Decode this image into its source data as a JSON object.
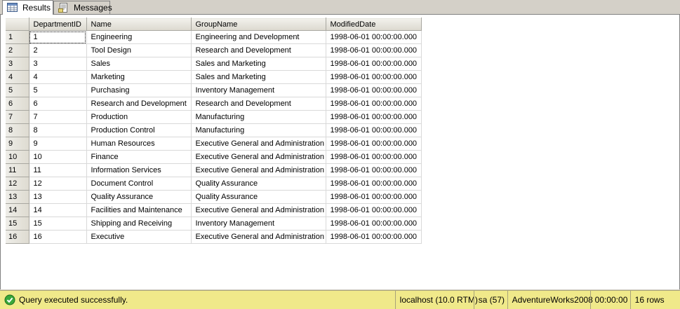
{
  "tabs": [
    {
      "label": "Results",
      "icon": "grid-results-icon",
      "active": true
    },
    {
      "label": "Messages",
      "icon": "messages-icon",
      "active": false
    }
  ],
  "grid": {
    "columns": [
      "DepartmentID",
      "Name",
      "GroupName",
      "ModifiedDate"
    ],
    "rows": [
      [
        "1",
        "1",
        "Engineering",
        "Engineering and Development",
        "1998-06-01 00:00:00.000"
      ],
      [
        "2",
        "2",
        "Tool Design",
        "Research and Development",
        "1998-06-01 00:00:00.000"
      ],
      [
        "3",
        "3",
        "Sales",
        "Sales and Marketing",
        "1998-06-01 00:00:00.000"
      ],
      [
        "4",
        "4",
        "Marketing",
        "Sales and Marketing",
        "1998-06-01 00:00:00.000"
      ],
      [
        "5",
        "5",
        "Purchasing",
        "Inventory Management",
        "1998-06-01 00:00:00.000"
      ],
      [
        "6",
        "6",
        "Research and Development",
        "Research and Development",
        "1998-06-01 00:00:00.000"
      ],
      [
        "7",
        "7",
        "Production",
        "Manufacturing",
        "1998-06-01 00:00:00.000"
      ],
      [
        "8",
        "8",
        "Production Control",
        "Manufacturing",
        "1998-06-01 00:00:00.000"
      ],
      [
        "9",
        "9",
        "Human Resources",
        "Executive General and Administration",
        "1998-06-01 00:00:00.000"
      ],
      [
        "10",
        "10",
        "Finance",
        "Executive General and Administration",
        "1998-06-01 00:00:00.000"
      ],
      [
        "11",
        "11",
        "Information Services",
        "Executive General and Administration",
        "1998-06-01 00:00:00.000"
      ],
      [
        "12",
        "12",
        "Document Control",
        "Quality Assurance",
        "1998-06-01 00:00:00.000"
      ],
      [
        "13",
        "13",
        "Quality Assurance",
        "Quality Assurance",
        "1998-06-01 00:00:00.000"
      ],
      [
        "14",
        "14",
        "Facilities and Maintenance",
        "Executive General and Administration",
        "1998-06-01 00:00:00.000"
      ],
      [
        "15",
        "15",
        "Shipping and Receiving",
        "Inventory Management",
        "1998-06-01 00:00:00.000"
      ],
      [
        "16",
        "16",
        "Executive",
        "Executive General and Administration",
        "1998-06-01 00:00:00.000"
      ]
    ]
  },
  "statusbar": {
    "icon": "success-check-icon",
    "message": "Query executed successfully.",
    "server": "localhost (10.0 RTM)",
    "user": "sa (57)",
    "database": "AdventureWorks2008",
    "elapsed": "00:00:00",
    "row_count": "16 rows",
    "color": "#f0e98a"
  }
}
